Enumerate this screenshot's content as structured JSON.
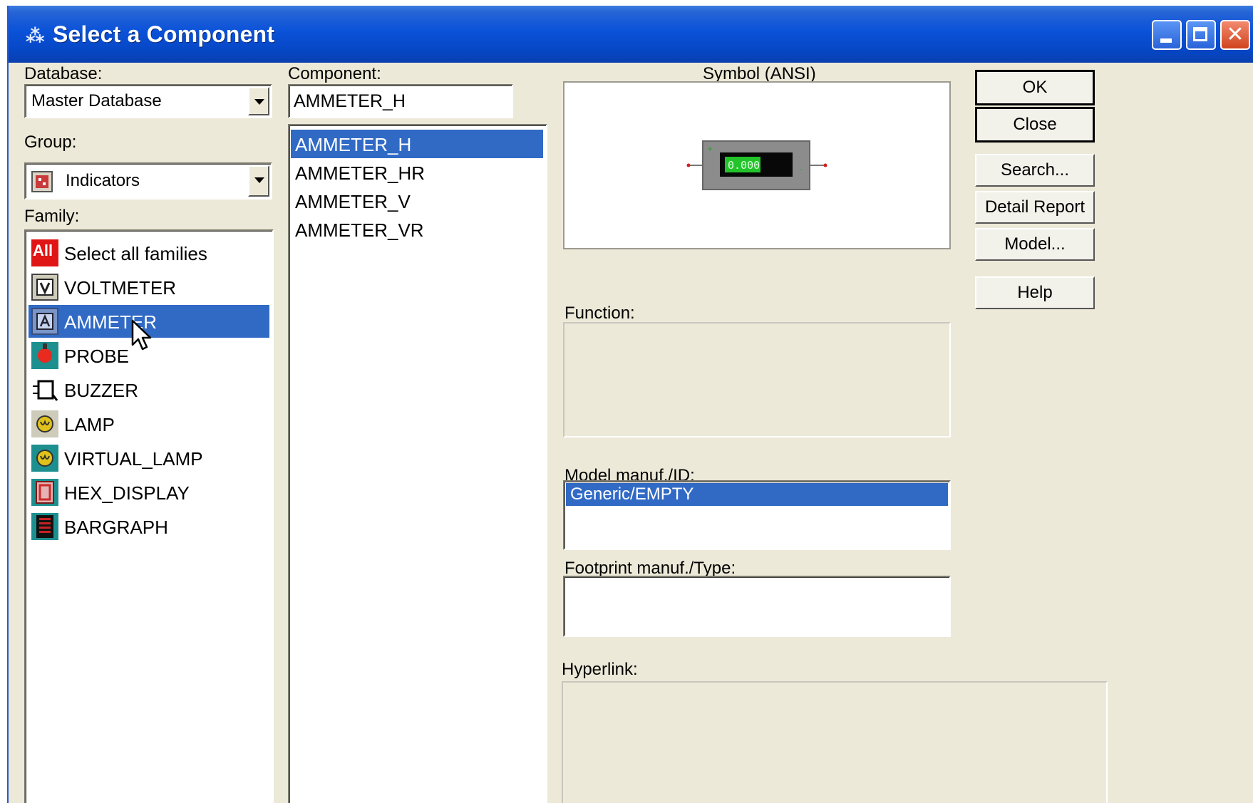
{
  "window": {
    "title": "Select a Component",
    "logo_icon": "multisim-logo-icon",
    "controls": [
      "minimize-icon",
      "maximize-icon",
      "close-icon"
    ]
  },
  "database": {
    "label": "Database:",
    "value": "Master Database"
  },
  "group": {
    "label": "Group:",
    "value": "Indicators",
    "icon": "indicators-icon"
  },
  "family": {
    "label": "Family:",
    "items": [
      {
        "label": "Select all families",
        "icon": "all-icon",
        "selected": false
      },
      {
        "label": "VOLTMETER",
        "icon": "voltmeter-icon",
        "selected": false
      },
      {
        "label": "AMMETER",
        "icon": "ammeter-icon",
        "selected": true
      },
      {
        "label": "PROBE",
        "icon": "probe-icon",
        "selected": false
      },
      {
        "label": "BUZZER",
        "icon": "buzzer-icon",
        "selected": false
      },
      {
        "label": "LAMP",
        "icon": "lamp-icon",
        "selected": false
      },
      {
        "label": "VIRTUAL_LAMP",
        "icon": "virtual-lamp-icon",
        "selected": false
      },
      {
        "label": "HEX_DISPLAY",
        "icon": "hex-display-icon",
        "selected": false
      },
      {
        "label": "BARGRAPH",
        "icon": "bargraph-icon",
        "selected": false
      }
    ],
    "all_badge": "All"
  },
  "component": {
    "label": "Component:",
    "value": "AMMETER_H",
    "items": [
      {
        "label": "AMMETER_H",
        "selected": true
      },
      {
        "label": "AMMETER_HR",
        "selected": false
      },
      {
        "label": "AMMETER_V",
        "selected": false
      },
      {
        "label": "AMMETER_VR",
        "selected": false
      }
    ]
  },
  "symbol": {
    "label": "Symbol (ANSI)",
    "display_value": "0.000"
  },
  "function": {
    "label": "Function:"
  },
  "model": {
    "label": "Model manuf./ID:",
    "items": [
      {
        "label": "Generic/EMPTY",
        "selected": true
      }
    ]
  },
  "footprint": {
    "label": "Footprint manuf./Type:"
  },
  "hyperlink": {
    "label": "Hyperlink:"
  },
  "buttons": {
    "ok": "OK",
    "close": "Close",
    "search": "Search...",
    "detail_report": "Detail Report",
    "model": "Model...",
    "help": "Help"
  },
  "colors": {
    "titlebar": "#0a52d9",
    "selection": "#316ac5",
    "dialog_bg": "#ece9d8",
    "close_button": "#d0441e",
    "display_green": "#22c42a"
  }
}
